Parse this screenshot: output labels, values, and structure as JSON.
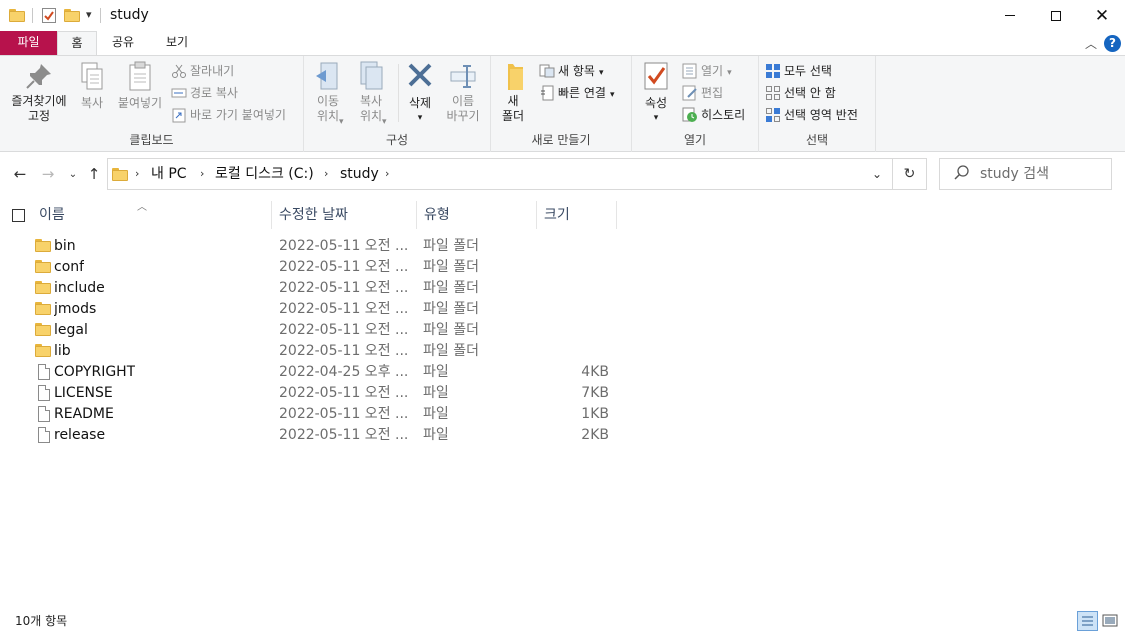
{
  "window": {
    "title": "study",
    "quick_access": [
      "properties-icon",
      "new-folder-icon",
      "customize-quick-access-icon"
    ],
    "controls": [
      "minimize-icon",
      "maximize-icon",
      "close-icon"
    ]
  },
  "ribbon_tabs": [
    {
      "label": "파일",
      "active_color": "#b7124c"
    },
    {
      "label": "홈"
    },
    {
      "label": "공유"
    },
    {
      "label": "보기"
    }
  ],
  "ribbon": {
    "clipboard": {
      "label": "클립보드",
      "pin": "즐겨찾기에\n고정",
      "copy": "복사",
      "paste": "붙여넣기",
      "cut": "잘라내기",
      "copy_path": "경로 복사",
      "paste_shortcut": "바로 가기 붙여넣기"
    },
    "organize": {
      "label": "구성",
      "move_to": "이동\n위치",
      "copy_to": "복사\n위치",
      "delete": "삭제",
      "rename": "이름\n바꾸기"
    },
    "new": {
      "label": "새로 만들기",
      "new_folder": "새\n폴더",
      "new_item": "새 항목",
      "easy_access": "빠른 연결"
    },
    "open": {
      "label": "열기",
      "properties": "속성",
      "open": "열기",
      "edit": "편집",
      "history": "히스토리"
    },
    "select": {
      "label": "선택",
      "select_all": "모두 선택",
      "select_none": "선택 안 함",
      "invert": "선택 영역 반전"
    }
  },
  "address": {
    "crumbs": [
      "내 PC",
      "로컬 디스크 (C:)",
      "study"
    ],
    "search_placeholder": "study 검색"
  },
  "columns": {
    "name": "이름",
    "date": "수정한 날짜",
    "type": "유형",
    "size": "크기"
  },
  "files": [
    {
      "name": "bin",
      "date": "2022-05-11 오전 ...",
      "type": "파일 폴더",
      "size": "",
      "kind": "folder"
    },
    {
      "name": "conf",
      "date": "2022-05-11 오전 ...",
      "type": "파일 폴더",
      "size": "",
      "kind": "folder"
    },
    {
      "name": "include",
      "date": "2022-05-11 오전 ...",
      "type": "파일 폴더",
      "size": "",
      "kind": "folder"
    },
    {
      "name": "jmods",
      "date": "2022-05-11 오전 ...",
      "type": "파일 폴더",
      "size": "",
      "kind": "folder"
    },
    {
      "name": "legal",
      "date": "2022-05-11 오전 ...",
      "type": "파일 폴더",
      "size": "",
      "kind": "folder"
    },
    {
      "name": "lib",
      "date": "2022-05-11 오전 ...",
      "type": "파일 폴더",
      "size": "",
      "kind": "folder"
    },
    {
      "name": "COPYRIGHT",
      "date": "2022-04-25 오후 ...",
      "type": "파일",
      "size": "4KB",
      "kind": "file"
    },
    {
      "name": "LICENSE",
      "date": "2022-05-11 오전 ...",
      "type": "파일",
      "size": "7KB",
      "kind": "file"
    },
    {
      "name": "README",
      "date": "2022-05-11 오전 ...",
      "type": "파일",
      "size": "1KB",
      "kind": "file"
    },
    {
      "name": "release",
      "date": "2022-05-11 오전 ...",
      "type": "파일",
      "size": "2KB",
      "kind": "file"
    }
  ],
  "status": {
    "item_count": "10개 항목"
  },
  "colors": {
    "file_tab": "#b7124c",
    "folder": "#f8d26a",
    "help": "#1565c0",
    "header_text": "#3a4a63"
  }
}
